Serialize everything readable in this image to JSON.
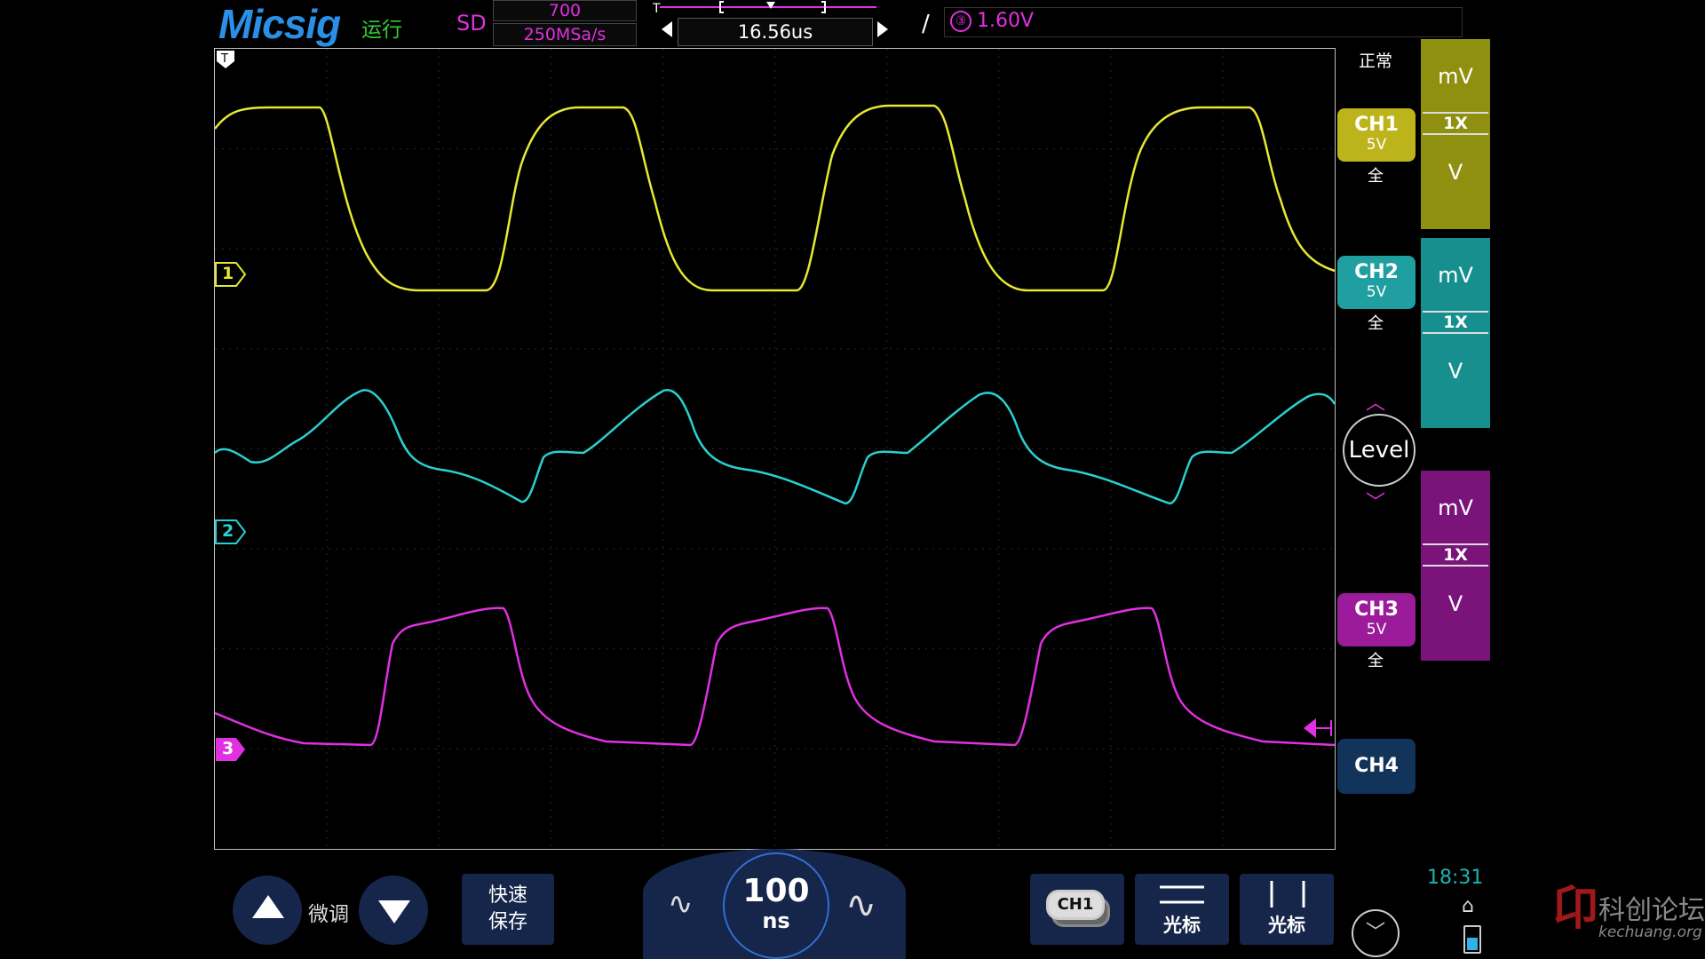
{
  "header": {
    "brand": "Micsig",
    "run_state": "运行",
    "acq_mode": "SD",
    "memory_depth": "700",
    "sample_rate": "250MSa/s",
    "trigger_position": "16.56us",
    "trigger_source": "③",
    "trigger_level": "1.60V"
  },
  "plot": {
    "markers": [
      {
        "label": "1",
        "color": "#e8e832"
      },
      {
        "label": "2",
        "color": "#2ad0d0"
      },
      {
        "label": "3",
        "color": "#e030e0"
      }
    ],
    "trigger_marker": "T"
  },
  "right_panel": {
    "trigger_mode": "正常",
    "channels": [
      {
        "name": "CH1",
        "scale": "5V",
        "bandwidth": "全",
        "color": "#bdb41c",
        "probe_top": "mV",
        "probe_mult": "1X",
        "probe_bottom": "V",
        "probe_color": "#8f8f10"
      },
      {
        "name": "CH2",
        "scale": "5V",
        "bandwidth": "全",
        "color": "#1f9f9f",
        "probe_top": "mV",
        "probe_mult": "1X",
        "probe_bottom": "V",
        "probe_color": "#178f8f"
      },
      {
        "name": "CH3",
        "scale": "5V",
        "bandwidth": "全",
        "color": "#9b1b9b",
        "probe_top": "mV",
        "probe_mult": "1X",
        "probe_bottom": "V",
        "probe_color": "#7a147a"
      }
    ],
    "level_label": "Level",
    "ch4_label": "CH4"
  },
  "bottom": {
    "fine_label": "微调",
    "quick_save": "快速\n保存",
    "timebase_value": "100",
    "timebase_unit": "ns",
    "source_tag": "CH1",
    "hcursor_label": "光标",
    "vcursor_label": "光标",
    "clock": "18:31"
  },
  "watermark": {
    "text": "科创论坛",
    "url": "kechuang.org"
  }
}
